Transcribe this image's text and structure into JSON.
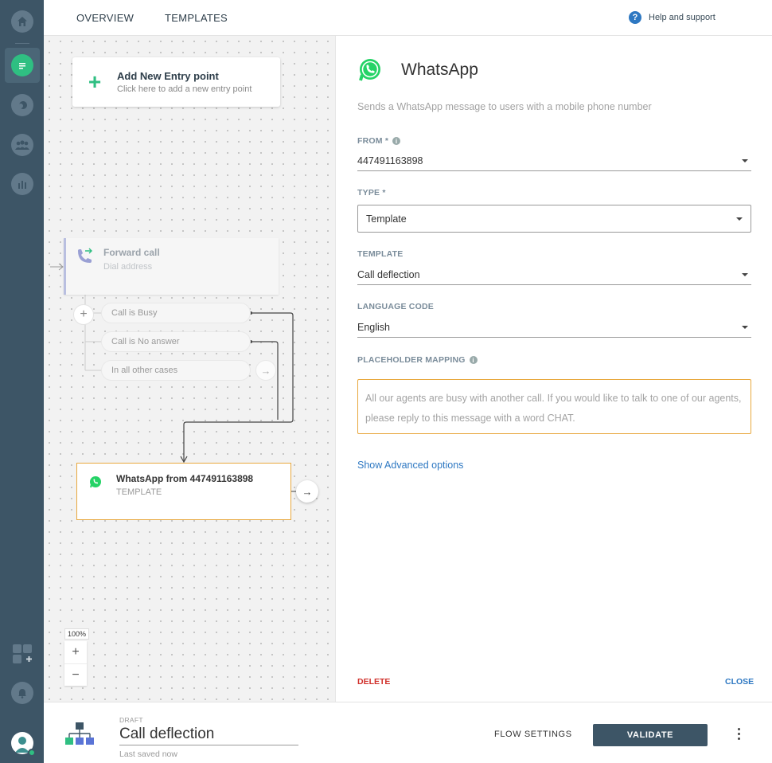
{
  "topbar": {
    "tabs": [
      {
        "label": "OVERVIEW"
      },
      {
        "label": "TEMPLATES"
      }
    ],
    "help_label": "Help and support"
  },
  "canvas": {
    "entry": {
      "title": "Add New Entry point",
      "subtitle": "Click here to add a new entry point"
    },
    "forward_call": {
      "title": "Forward call",
      "subtitle": "Dial address"
    },
    "conditions": [
      {
        "label": "Call is Busy"
      },
      {
        "label": "Call is No answer"
      },
      {
        "label": "In all other cases"
      }
    ],
    "whatsapp_node": {
      "title": "WhatsApp from 447491163898",
      "subtitle": "TEMPLATE"
    },
    "zoom_level": "100%"
  },
  "panel": {
    "title": "WhatsApp",
    "description": "Sends a WhatsApp message to users with a mobile phone number",
    "from": {
      "label": "FROM *",
      "value": "447491163898"
    },
    "type": {
      "label": "TYPE *",
      "value": "Template"
    },
    "template": {
      "label": "TEMPLATE",
      "value": "Call deflection"
    },
    "language": {
      "label": "LANGUAGE CODE",
      "value": "English"
    },
    "placeholder": {
      "label": "PLACEHOLDER MAPPING",
      "value": "All our agents are busy with another call. If you would like to talk to one of our agents, please reply to this message with a word CHAT."
    },
    "advanced_label": "Show Advanced options",
    "delete_label": "DELETE",
    "close_label": "CLOSE"
  },
  "bottom": {
    "status": "DRAFT",
    "flow_name": "Call deflection",
    "saved_text": "Last saved now",
    "settings_label": "FLOW SETTINGS",
    "validate_label": "VALIDATE"
  },
  "colors": {
    "rail": "#3d5566",
    "accent_green": "#2fbf82",
    "whatsapp_green": "#25d366",
    "link_blue": "#2e78c2",
    "selected_border": "#e8a83e",
    "danger": "#d0302b"
  }
}
